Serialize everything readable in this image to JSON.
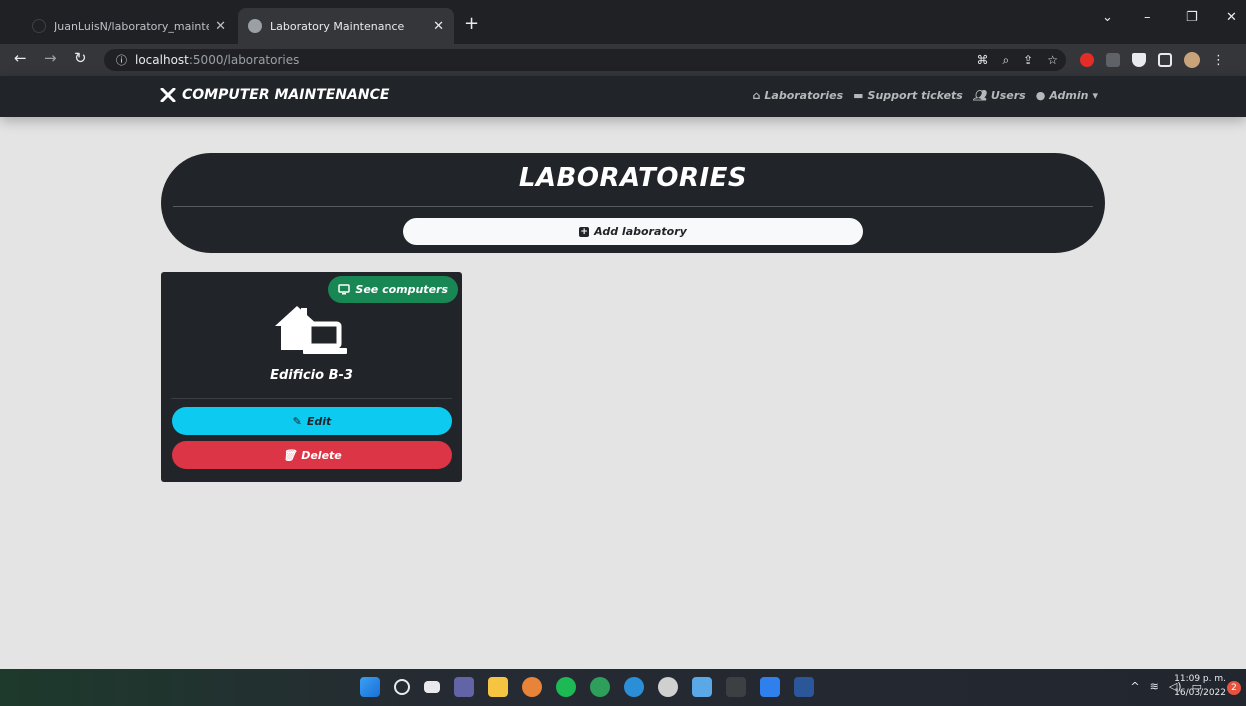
{
  "browser": {
    "tabs": [
      {
        "title": "JuanLuisN/laboratory_maintenan",
        "close": "✕"
      },
      {
        "title": "Laboratory Maintenance",
        "close": "✕"
      }
    ],
    "new_tab": "+",
    "url_host": "localhost",
    "url_path": ":5000/laboratories"
  },
  "navbar": {
    "brand": "COMPUTER MAINTENANCE",
    "links": [
      {
        "label": "Laboratories"
      },
      {
        "label": "Support tickets"
      },
      {
        "label": "Users"
      },
      {
        "label": "Admin"
      }
    ]
  },
  "page": {
    "title": "LABORATORIES",
    "add_button": "Add laboratory"
  },
  "labs": [
    {
      "name": "Edificio B-3",
      "see_button": "See computers",
      "edit_button": "Edit",
      "delete_button": "Delete"
    }
  ],
  "taskbar": {
    "time": "11:09 p. m.",
    "date": "16/03/2022",
    "notifications": "2"
  },
  "colors": {
    "navbar_bg": "#212529",
    "page_bg": "#e4e4e4",
    "success": "#198754",
    "info": "#0dcaf0",
    "danger": "#dc3545"
  }
}
